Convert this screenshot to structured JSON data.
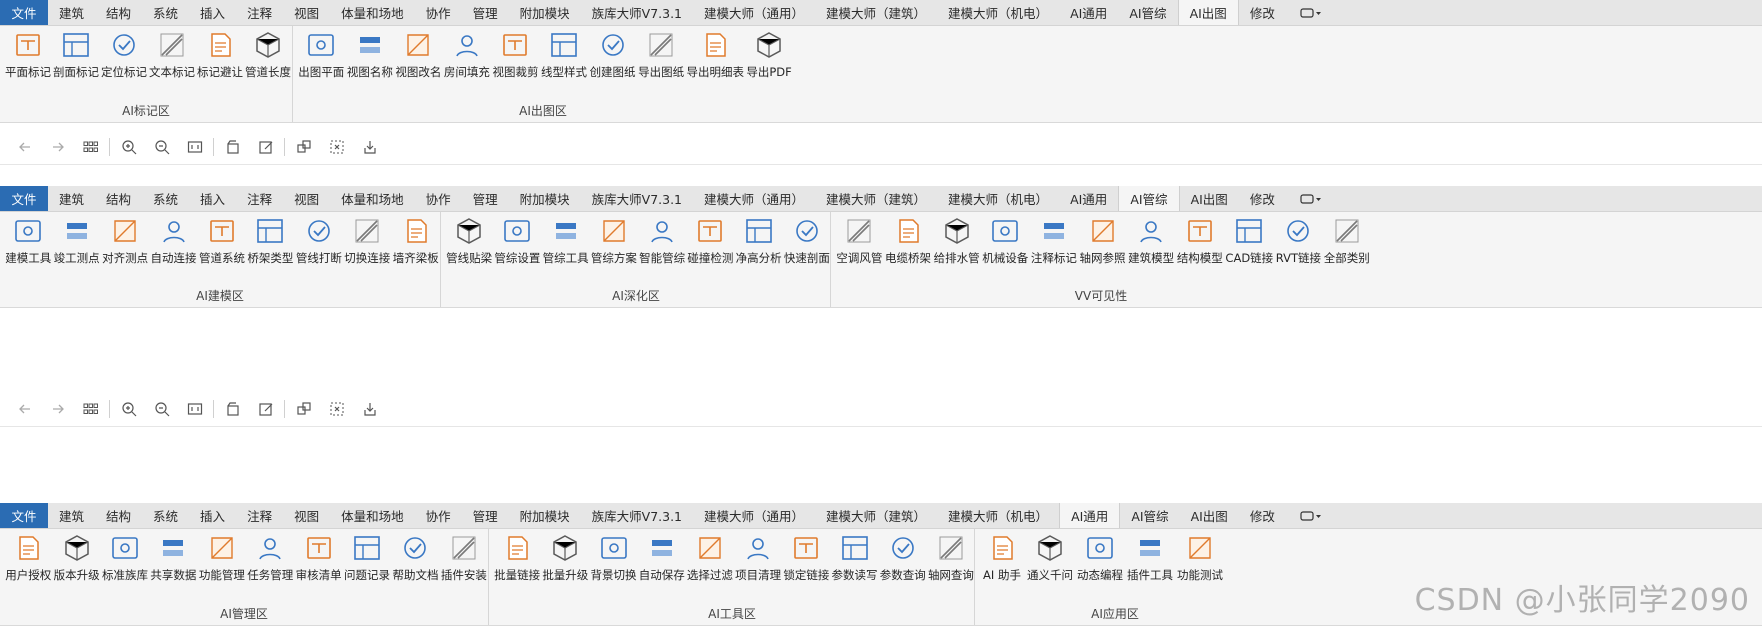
{
  "tabs_common": [
    "文件",
    "建筑",
    "结构",
    "系统",
    "插入",
    "注释",
    "视图",
    "体量和场地",
    "协作",
    "管理",
    "附加模块",
    "族库大师V7.3.1",
    "建模大师（通用）",
    "建模大师（建筑）",
    "建模大师（机电）",
    "AI通用",
    "AI管综",
    "AI出图",
    "修改"
  ],
  "sections": [
    {
      "active_tab": "AI出图",
      "panels": [
        {
          "label": "AI标记区",
          "tools": [
            "平面标记",
            "剖面标记",
            "定位标记",
            "文本标记",
            "标记避让",
            "管道长度"
          ]
        },
        {
          "label": "AI出图区",
          "tools": [
            "出图平面",
            "视图名称",
            "视图改名",
            "房间填充",
            "视图裁剪",
            "线型样式",
            "创建图纸",
            "导出图纸",
            "导出明细表",
            "导出PDF"
          ]
        }
      ]
    },
    {
      "active_tab": "AI管综",
      "panels": [
        {
          "label": "AI建模区",
          "tools": [
            "建模工具",
            "竣工测点",
            "对齐测点",
            "自动连接",
            "管道系统",
            "桥架类型",
            "管线打断",
            "切换连接",
            "墙齐梁板"
          ]
        },
        {
          "label": "AI深化区",
          "tools": [
            "管线贴梁",
            "管综设置",
            "管综工具",
            "管综方案",
            "智能管综",
            "碰撞检测",
            "净高分析",
            "快速剖面"
          ]
        },
        {
          "label": "VV可见性",
          "tools": [
            "空调风管",
            "电缆桥架",
            "给排水管",
            "机械设备",
            "注释标记",
            "轴网参照",
            "建筑模型",
            "结构模型",
            "CAD链接",
            "RVT链接",
            "全部类别"
          ]
        }
      ]
    },
    {
      "active_tab": "AI通用",
      "panels": [
        {
          "label": "AI管理区",
          "tools": [
            "用户授权",
            "版本升级",
            "标准族库",
            "共享数据",
            "功能管理",
            "任务管理",
            "审核清单",
            "问题记录",
            "帮助文档",
            "插件安装"
          ]
        },
        {
          "label": "AI工具区",
          "tools": [
            "批量链接",
            "批量升级",
            "背景切换",
            "自动保存",
            "选择过滤",
            "项目清理",
            "锁定链接",
            "参数读写",
            "参数查询",
            "轴网查询"
          ]
        },
        {
          "label": "AI应用区",
          "tools": [
            "AI 助手",
            "通义千问",
            "动态编程",
            "插件工具",
            "功能测试"
          ]
        }
      ]
    }
  ],
  "nav_icons": [
    "back-arrow-icon",
    "forward-arrow-icon",
    "grid-icon",
    "zoom-in-icon",
    "zoom-out-icon",
    "fit-view-icon",
    "rotate-icon",
    "edit-icon",
    "tile-icon",
    "close-inactive-icon",
    "export-icon"
  ],
  "watermark": "CSDN @小张同学2090",
  "colors": {
    "file_tab": "#2b6cb3",
    "ribbon_bg": "#f5f5f5",
    "tabbar_bg": "#e6e6e6",
    "icon_blue": "#3a78c4",
    "icon_orange": "#e07b2c"
  }
}
